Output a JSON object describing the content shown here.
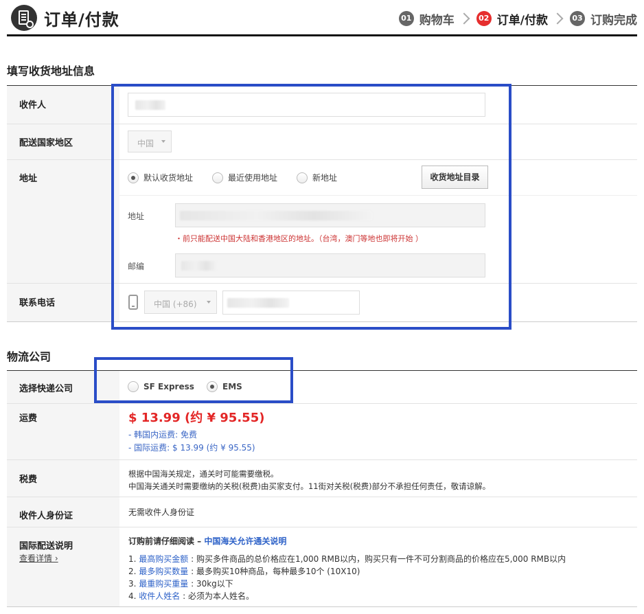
{
  "header": {
    "title": "订单/付款",
    "steps": [
      {
        "num": "01",
        "label": "购物车"
      },
      {
        "num": "02",
        "label": "订单/付款"
      },
      {
        "num": "03",
        "label": "订购完成"
      }
    ]
  },
  "address_section": {
    "title": "填写收货地址信息",
    "recipient_label": "收件人",
    "country_label": "配送国家地区",
    "country_value": "中国",
    "address_label": "地址",
    "radio_default": "默认收货地址",
    "radio_recent": "最近使用地址",
    "radio_new": "新地址",
    "address_book_button": "收货地址目录",
    "address_sub_label": "地址",
    "address_warning": "・前只能配送中国大陆和香港地区的地址。（台湾，澳门等地也即将开始 ）",
    "zip_label": "邮编",
    "phone_label": "联系电话",
    "phone_country": "中国 (+86)"
  },
  "logistics_section": {
    "title": "物流公司",
    "carrier_label": "选择快递公司",
    "carrier_sf": "SF Express",
    "carrier_ems": "EMS",
    "shipping_label": "运费",
    "shipping_price": "$ 13.99 (约 ¥ 95.55)",
    "domestic_note": "- 韩国内运费: 免费",
    "intl_note": "- 国际运费:  $ 13.99 (约 ¥ 95.55)",
    "tax_label": "税费",
    "tax_line1": "根据中国海关规定，通关时可能需要缴税。",
    "tax_line2": "中国海关通关时需要缴纳的关税(税费)由买家支付。11街对关税(税费)部分不承担任何责任，敬请谅解。",
    "id_label": "收件人身份证",
    "id_value": "无需收件人身份证",
    "intl_label": "国际配送说明",
    "intl_details": "查看详情 ›",
    "intl_title_prefix": "订购前请仔细阅读 – ",
    "intl_title_link": "中国海关允许通关说明",
    "rules": [
      {
        "num": "1. ",
        "key": "最高购买金额",
        "text": " : 购买多件商品的总价格应在1,000 RMB以内，购买只有一件不可分割商品的价格应在5,000 RMB以内"
      },
      {
        "num": "2. ",
        "key": "最多购买数量",
        "text": " : 最多购买10种商品，每种最多10个 (10X10)"
      },
      {
        "num": "3. ",
        "key": "最重购买重量",
        "text": " : 30kg以下"
      },
      {
        "num": "4. ",
        "key": "收件人姓名",
        "text": " : 必须为本人姓名。"
      }
    ]
  },
  "colors": {
    "accent_red": "#e62e2e",
    "link_blue": "#2e62c8",
    "highlight_box": "#2a4dc7"
  }
}
